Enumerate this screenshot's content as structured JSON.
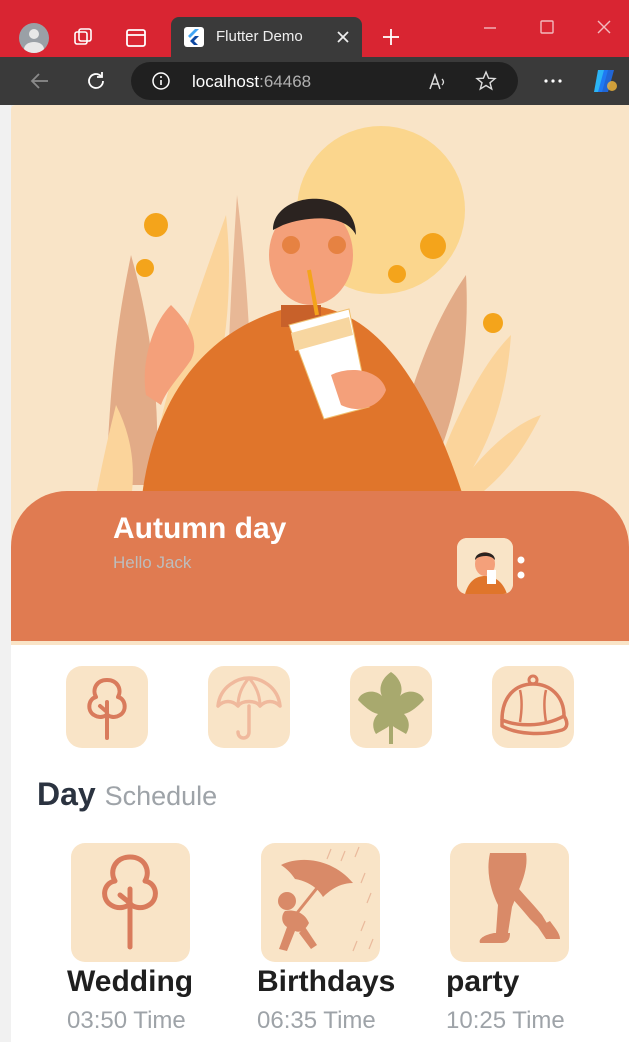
{
  "browser": {
    "tab_title": "Flutter Demo",
    "url_host": "localhost",
    "url_port": ":64468"
  },
  "header": {
    "title": "Autumn day",
    "subtitle": "Hello Jack"
  },
  "categories": [
    {
      "icon": "tree-icon"
    },
    {
      "icon": "umbrella-icon"
    },
    {
      "icon": "leaf-icon"
    },
    {
      "icon": "cap-icon"
    }
  ],
  "section": {
    "title": "Day",
    "subtitle": "Schedule"
  },
  "events": [
    {
      "name": "Wedding",
      "time": "03:50 Time",
      "icon": "tree-icon"
    },
    {
      "name": "Birthdays",
      "time": "06:35 Time",
      "icon": "umbrella-person-icon"
    },
    {
      "name": "party",
      "time": "10:25 Time",
      "icon": "walking-legs-icon"
    }
  ],
  "colors": {
    "accent": "#e07b51",
    "cream": "#f9e4c7",
    "browser_frame": "#d92532",
    "leaf_green": "#a8a96e"
  }
}
